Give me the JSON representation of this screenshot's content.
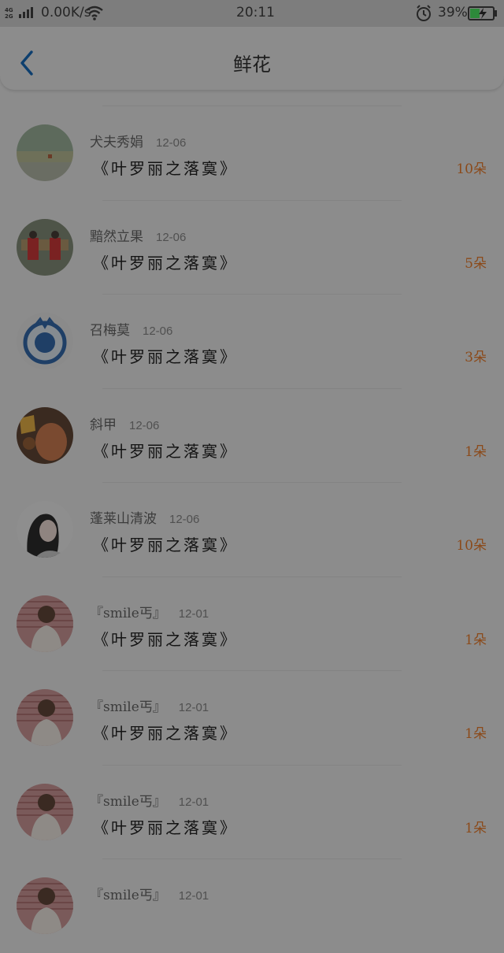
{
  "status_bar": {
    "network": "4G 2G",
    "speed": "0.00K/s",
    "time": "20:11",
    "battery": "39%"
  },
  "header": {
    "title": "鲜花"
  },
  "records": [
    {
      "name": "犬夫秀娟",
      "date": "12-06",
      "gift": "《叶罗丽之落寞》",
      "count": "10朵"
    },
    {
      "name": "黯然立果",
      "date": "12-06",
      "gift": "《叶罗丽之落寞》",
      "count": "5朵"
    },
    {
      "name": "召梅莫",
      "date": "12-06",
      "gift": "《叶罗丽之落寞》",
      "count": "3朵"
    },
    {
      "name": "斜甲",
      "date": "12-06",
      "gift": "《叶罗丽之落寞》",
      "count": "1朵"
    },
    {
      "name": "蓬莱山清波",
      "date": "12-06",
      "gift": "《叶罗丽之落寞》",
      "count": "10朵"
    },
    {
      "name": "『smile丐』",
      "date": "12-01",
      "gift": "《叶罗丽之落寞》",
      "count": "1朵"
    },
    {
      "name": "『smile丐』",
      "date": "12-01",
      "gift": "《叶罗丽之落寞》",
      "count": "1朵"
    },
    {
      "name": "『smile丐』",
      "date": "12-01",
      "gift": "《叶罗丽之落寞》",
      "count": "1朵"
    },
    {
      "name": "『smile丐』",
      "date": "12-01",
      "gift": "",
      "count": ""
    }
  ]
}
